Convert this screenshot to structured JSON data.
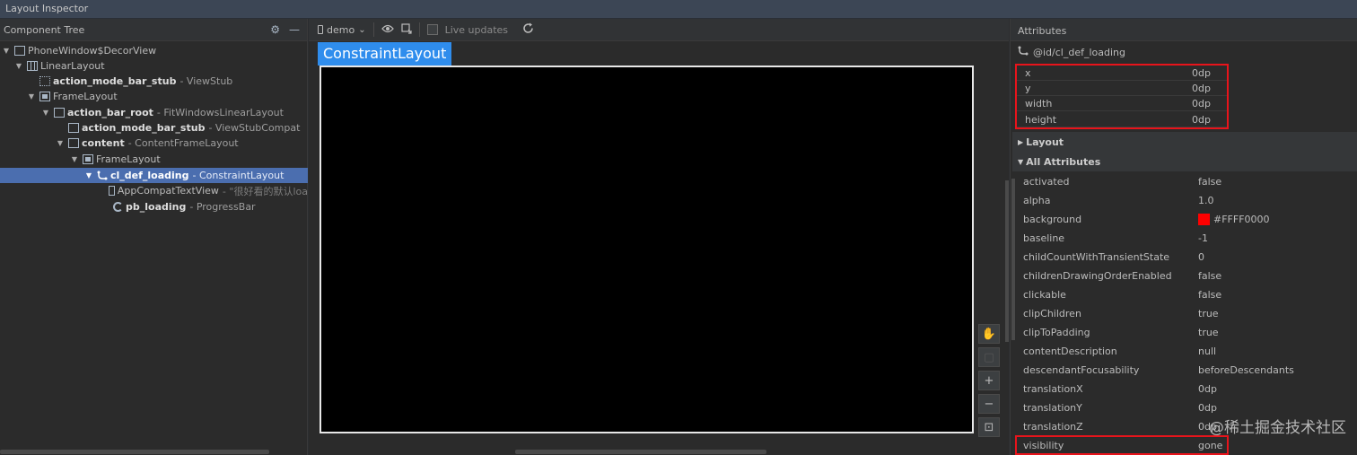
{
  "window": {
    "title": "Layout Inspector"
  },
  "tree": {
    "title": "Component Tree",
    "settings_icon": "⚙",
    "collapse_icon": "—",
    "nodes": [
      {
        "name": "PhoneWindow$DecorView",
        "type": ""
      },
      {
        "name": "LinearLayout",
        "type": ""
      },
      {
        "name": "action_mode_bar_stub",
        "type": "- ViewStub"
      },
      {
        "name": "FrameLayout",
        "type": ""
      },
      {
        "name": "action_bar_root",
        "type": "- FitWindowsLinearLayout"
      },
      {
        "name": "action_mode_bar_stub",
        "type": "- ViewStubCompat"
      },
      {
        "name": "content",
        "type": "- ContentFrameLayout"
      },
      {
        "name": "FrameLayout",
        "type": ""
      },
      {
        "name": "cl_def_loading",
        "type": "- ConstraintLayout"
      },
      {
        "name": "AppCompatTextView",
        "type": "- \"很好看的默认loa"
      },
      {
        "name": "pb_loading",
        "type": "- ProgressBar"
      }
    ]
  },
  "canvas": {
    "device": "demo",
    "device_chevron": "⌄",
    "live_updates": "Live updates",
    "view_label": "ConstraintLayout"
  },
  "attributes": {
    "title": "Attributes",
    "selected_id": "@id/cl_def_loading",
    "geometry": [
      {
        "key": "x",
        "value": "0dp"
      },
      {
        "key": "y",
        "value": "0dp"
      },
      {
        "key": "width",
        "value": "0dp"
      },
      {
        "key": "height",
        "value": "0dp"
      }
    ],
    "sections": {
      "layout": "Layout",
      "all": "All Attributes"
    },
    "rows": [
      {
        "key": "activated",
        "value": "false"
      },
      {
        "key": "alpha",
        "value": "1.0"
      },
      {
        "key": "background",
        "value": "#FFFF0000",
        "swatch": "#ff0000"
      },
      {
        "key": "baseline",
        "value": "-1"
      },
      {
        "key": "childCountWithTransientState",
        "value": "0"
      },
      {
        "key": "childrenDrawingOrderEnabled",
        "value": "false"
      },
      {
        "key": "clickable",
        "value": "false"
      },
      {
        "key": "clipChildren",
        "value": "true"
      },
      {
        "key": "clipToPadding",
        "value": "true"
      },
      {
        "key": "contentDescription",
        "value": "null"
      },
      {
        "key": "descendantFocusability",
        "value": "beforeDescendants"
      },
      {
        "key": "translationX",
        "value": "0dp"
      },
      {
        "key": "translationY",
        "value": "0dp"
      },
      {
        "key": "translationZ",
        "value": "0dp"
      },
      {
        "key": "visibility",
        "value": "gone"
      }
    ]
  },
  "watermark": "@稀土掘金技术社区",
  "colors": {
    "selection": "#4b6eaf",
    "highlight": "#e8141b",
    "device_label": "#2f8ded"
  }
}
